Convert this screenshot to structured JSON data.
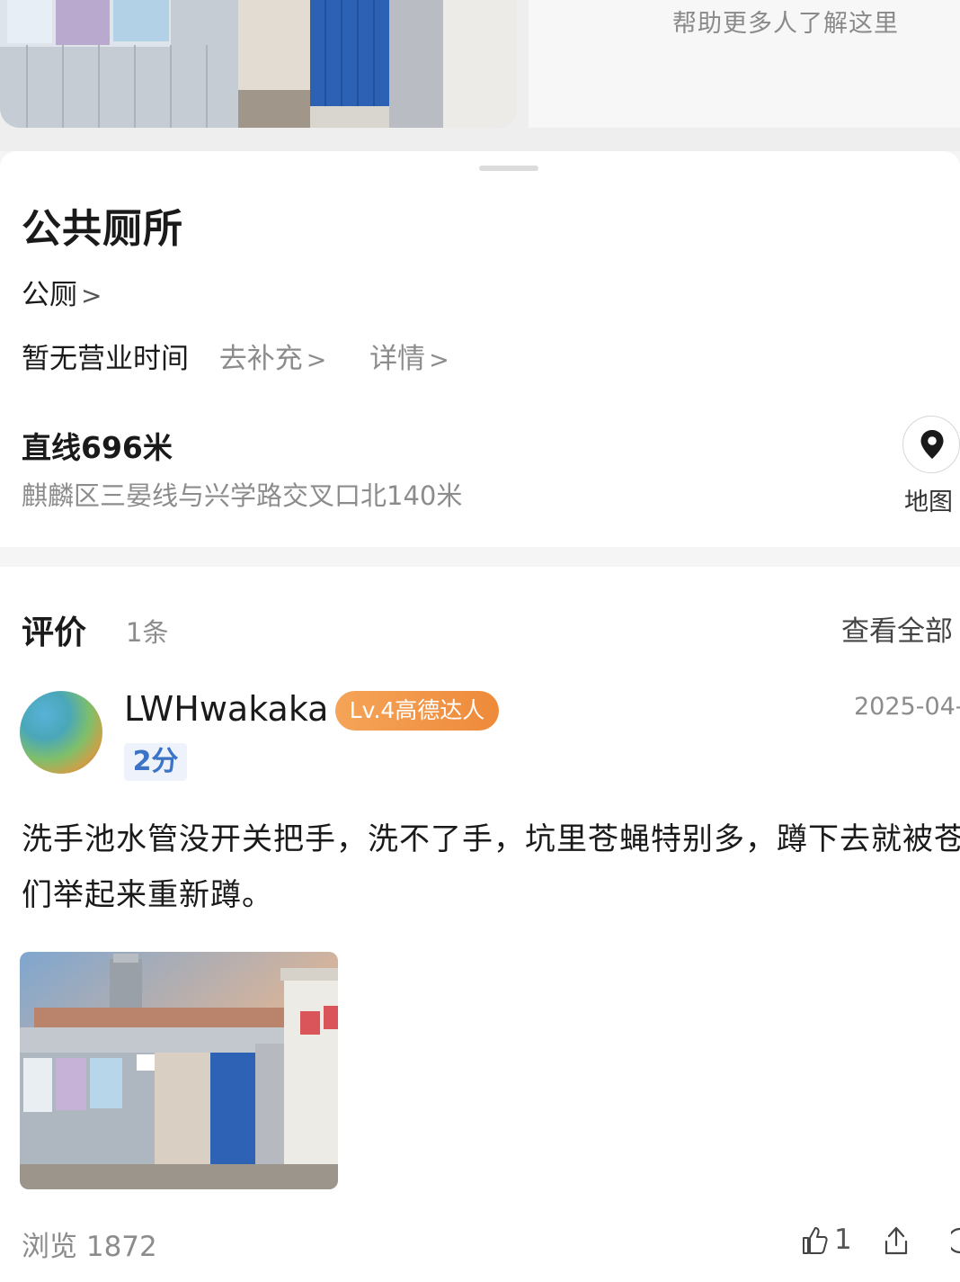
{
  "hero": {
    "help_text": "帮助更多人了解这里"
  },
  "poi": {
    "title": "公共厕所",
    "category": "公厕",
    "hours": "暂无营业时间",
    "add_info": "去补充",
    "details": "详情",
    "distance": "直线696米",
    "address": "麒麟区三晏线与兴学路交叉口北140米",
    "map_label": "地图",
    "map_icon": "location-pin-icon"
  },
  "reviews": {
    "title": "评价",
    "count": "1条",
    "see_all": "查看全部",
    "items": [
      {
        "user": "LWHwakaka",
        "badge": "Lv.4高德达人",
        "date": "2025-04-",
        "score": "2分",
        "text": "洗手池水管没开关把手，洗不了手，坑里苍蝇特别多，蹲下去就被苍蝇们举起来重新蹲。",
        "views": "浏览 1872",
        "likes": "1"
      }
    ]
  },
  "colors": {
    "badge": "#f09a48",
    "score_text": "#3b73c6",
    "muted": "#8c8c8c"
  }
}
